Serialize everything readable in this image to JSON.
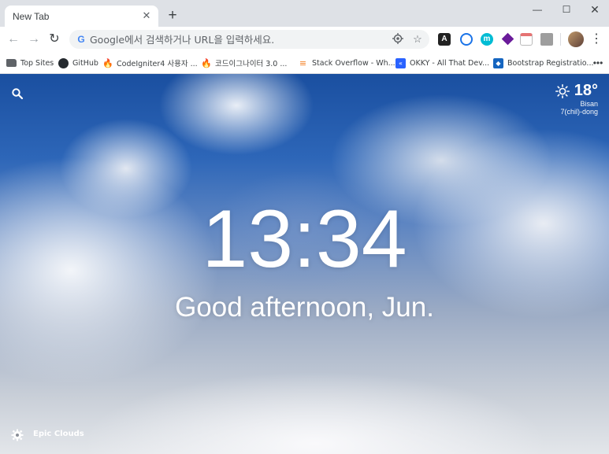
{
  "tab": {
    "title": "New Tab",
    "close_glyph": "✕"
  },
  "window": {
    "new_tab_glyph": "+",
    "minimize_glyph": "—",
    "maximize_glyph": "☐",
    "close_glyph": "✕"
  },
  "toolbar": {
    "back_glyph": "←",
    "forward_glyph": "→",
    "reload_glyph": "↻",
    "omnibox_placeholder": "Google에서 검색하거나 URL을 입력하세요.",
    "menu_glyph": "⋮"
  },
  "extensions": [
    "a-extension-icon",
    "ring-extension-icon",
    "m-extension-icon",
    "diamond-extension-icon",
    "calendar-extension-icon",
    "photo-extension-icon"
  ],
  "bookmarks": [
    {
      "label": "Top Sites",
      "icon": "folder-icon"
    },
    {
      "label": "GitHub",
      "icon": "github-icon"
    },
    {
      "label": "CodeIgniter4 사용자 ...",
      "icon": "flame-icon"
    },
    {
      "label": "코드이그나이터 3.0 ...",
      "icon": "flame-icon"
    },
    {
      "label": "Stack Overflow - Wh...",
      "icon": "stackoverflow-icon"
    },
    {
      "label": "OKKY - All That Dev...",
      "icon": "okky-icon"
    },
    {
      "label": "Bootstrap Registratio...",
      "icon": "bootstrap-icon"
    }
  ],
  "bookmarks_more": "•••",
  "momentum": {
    "weather": {
      "temperature": "18°",
      "location_line1": "Bisan",
      "location_line2": "7(chil)-dong"
    },
    "clock": "13:34",
    "greeting": "Good afternoon, Jun.",
    "photo_credit": "Epic Clouds"
  },
  "colors": {
    "tabstrip": "#dee1e6",
    "toolbar": "#ffffff",
    "sky_top": "#1a4fa0",
    "cloud": "#f5f7fa"
  }
}
